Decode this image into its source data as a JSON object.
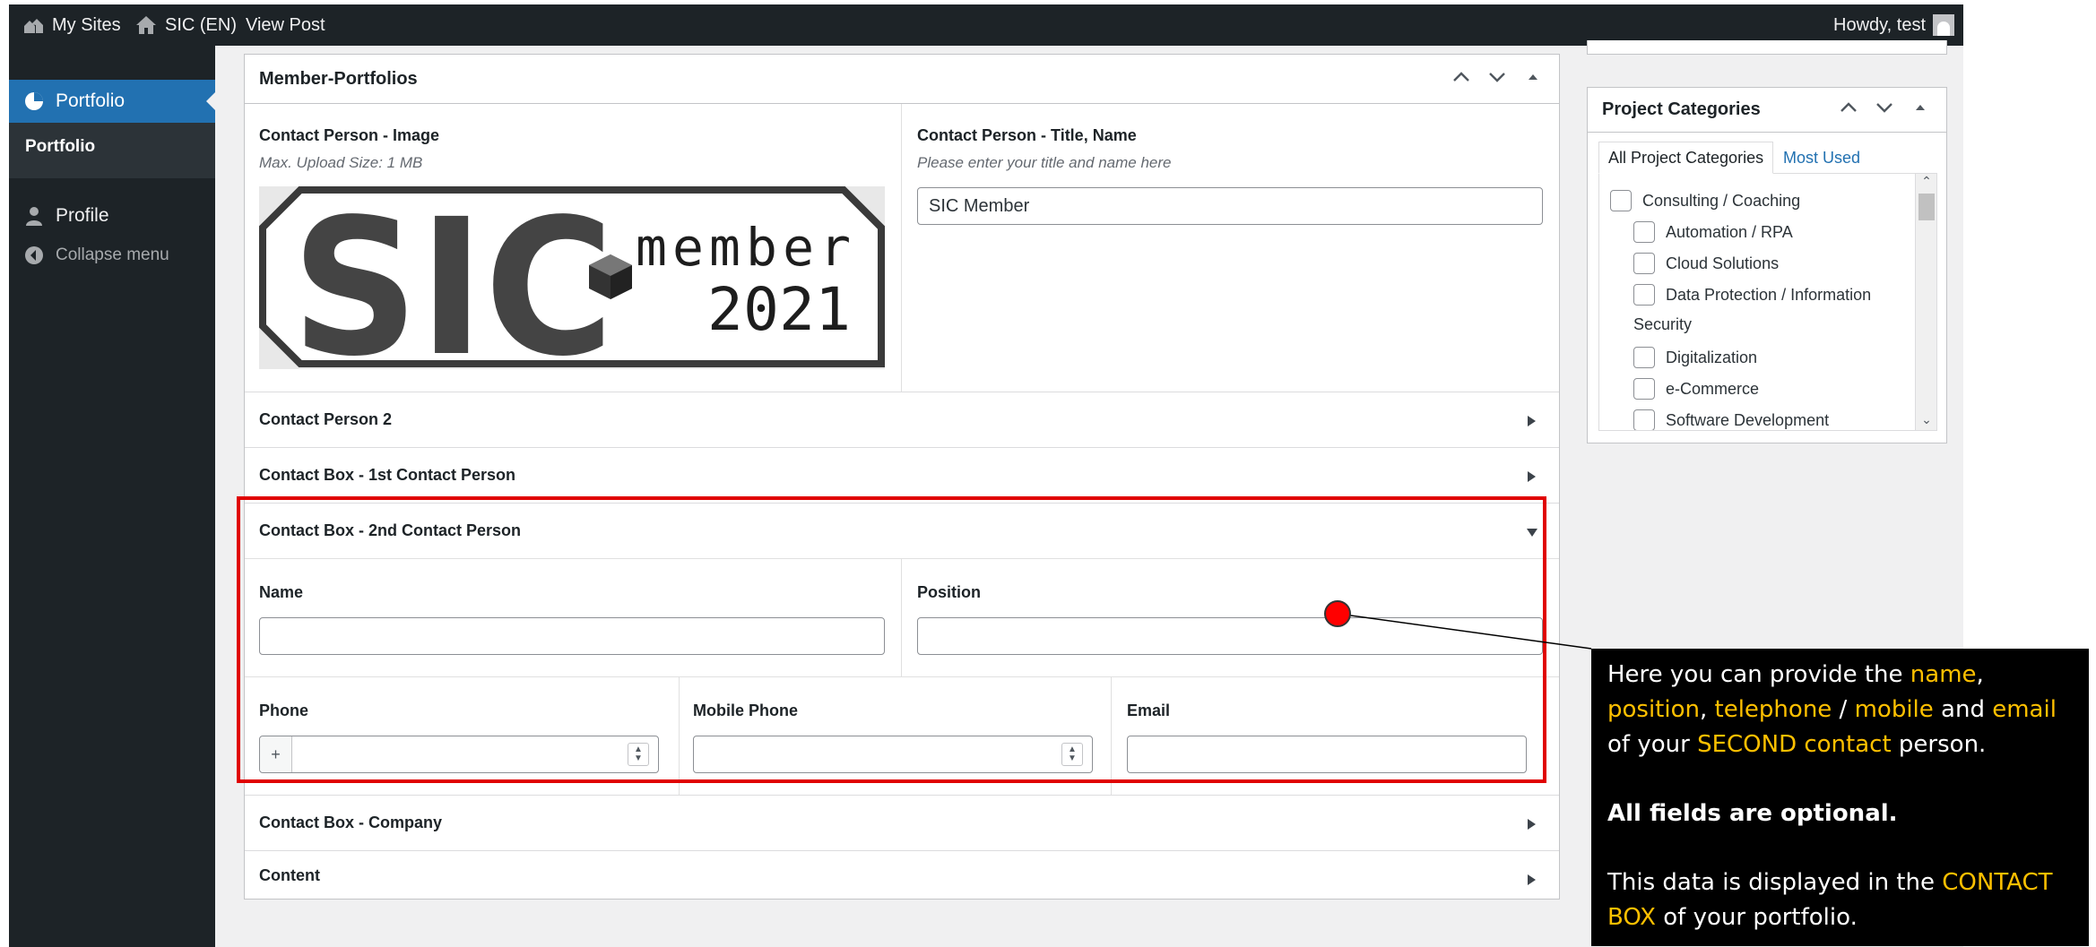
{
  "adminbar": {
    "my_sites": "My Sites",
    "site_name": "SIC (EN)",
    "view_post": "View Post",
    "howdy": "Howdy, test"
  },
  "sidemenu": {
    "portfolio": "Portfolio",
    "portfolio_sub": "Portfolio",
    "profile": "Profile",
    "collapse": "Collapse menu"
  },
  "postbox": {
    "title": "Member-Portfolios",
    "image_label": "Contact Person - Image",
    "image_desc": "Max. Upload Size: 1 MB",
    "logo_text_main": "SIC",
    "logo_text_member": "member",
    "logo_text_year": "2021",
    "title_name_label": "Contact Person - Title, Name",
    "title_name_desc": "Please enter your title and name here",
    "title_name_value": "SIC Member",
    "sections": {
      "contact_person_2": "Contact Person 2",
      "contact_box_1st": "Contact Box - 1st Contact Person",
      "contact_box_2nd": "Contact Box - 2nd Contact Person",
      "contact_box_company": "Contact Box - Company",
      "content": "Content"
    },
    "fields": {
      "name": "Name",
      "position": "Position",
      "phone": "Phone",
      "phone_prefix": "+",
      "mobile": "Mobile Phone",
      "email": "Email"
    }
  },
  "categories": {
    "title": "Project Categories",
    "tab_all": "All Project Categories",
    "tab_most": "Most Used",
    "items": [
      "Consulting / Coaching",
      "Automation / RPA",
      "Cloud Solutions",
      "Data Protection / Information",
      "Security",
      "Digitalization",
      "e-Commerce",
      "Software Development"
    ]
  },
  "tooltip": {
    "l1a": "Here you can provide the ",
    "l1b": "name",
    "l1c": ",",
    "l2a": "position",
    "l2b": ", ",
    "l2c": "telephone",
    "l2d": " / ",
    "l2e": "mobile",
    "l2f": " and ",
    "l2g": "email",
    "l3a": "of your ",
    "l3b": "SECOND contact",
    "l3c": " person.",
    "optional": "All fields are optional.",
    "l5a": "This data is displayed in the ",
    "l5b": "CONTACT",
    "l6a": "BOX",
    "l6b": " of your portfolio."
  },
  "colors": {
    "accent": "#2271b1",
    "highlight": "#e00000",
    "tooltip_highlight": "#ffc000"
  }
}
